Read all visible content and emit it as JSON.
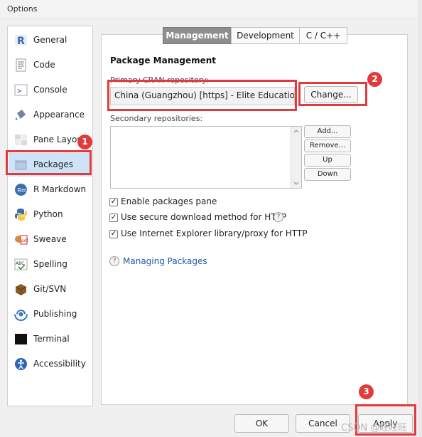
{
  "window": {
    "title": "Options"
  },
  "sidebar": {
    "items": [
      {
        "label": "General",
        "icon": "r-logo-icon"
      },
      {
        "label": "Code",
        "icon": "code-document-icon"
      },
      {
        "label": "Console",
        "icon": "console-prompt-icon"
      },
      {
        "label": "Appearance",
        "icon": "paint-bucket-icon"
      },
      {
        "label": "Pane Layout",
        "icon": "pane-grid-icon"
      },
      {
        "label": "Packages",
        "icon": "package-box-icon",
        "selected": true
      },
      {
        "label": "R Markdown",
        "icon": "rmd-icon"
      },
      {
        "label": "Python",
        "icon": "python-logo-icon"
      },
      {
        "label": "Sweave",
        "icon": "sweave-pdf-icon"
      },
      {
        "label": "Spelling",
        "icon": "spelling-abc-icon"
      },
      {
        "label": "Git/SVN",
        "icon": "git-box-icon"
      },
      {
        "label": "Publishing",
        "icon": "publishing-icon"
      },
      {
        "label": "Terminal",
        "icon": "terminal-icon"
      },
      {
        "label": "Accessibility",
        "icon": "accessibility-icon"
      }
    ]
  },
  "tabs": [
    {
      "label": "Management",
      "active": true
    },
    {
      "label": "Development",
      "active": false
    },
    {
      "label": "C / C++",
      "active": false
    }
  ],
  "packages": {
    "heading": "Package Management",
    "primary_label": "Primary CRAN repository:",
    "primary_value": "China (Guangzhou) [https] - Elite Education",
    "change_label": "Change...",
    "secondary_label": "Secondary repositories:",
    "secondary_buttons": [
      "Add...",
      "Remove...",
      "Up",
      "Down"
    ],
    "checkboxes": [
      {
        "label": "Enable packages pane",
        "checked": true
      },
      {
        "label": "Use secure download method for HTTP",
        "checked": true
      },
      {
        "label": "Use Internet Explorer library/proxy for HTTP",
        "checked": true
      }
    ],
    "help_link": "Managing Packages"
  },
  "footer": {
    "ok": "OK",
    "cancel": "Cancel",
    "apply": "Apply"
  },
  "annotations": {
    "badges": [
      "1",
      "2",
      "3"
    ],
    "color": "#e23b3b"
  },
  "watermark": "CSDN @旺旺旺"
}
